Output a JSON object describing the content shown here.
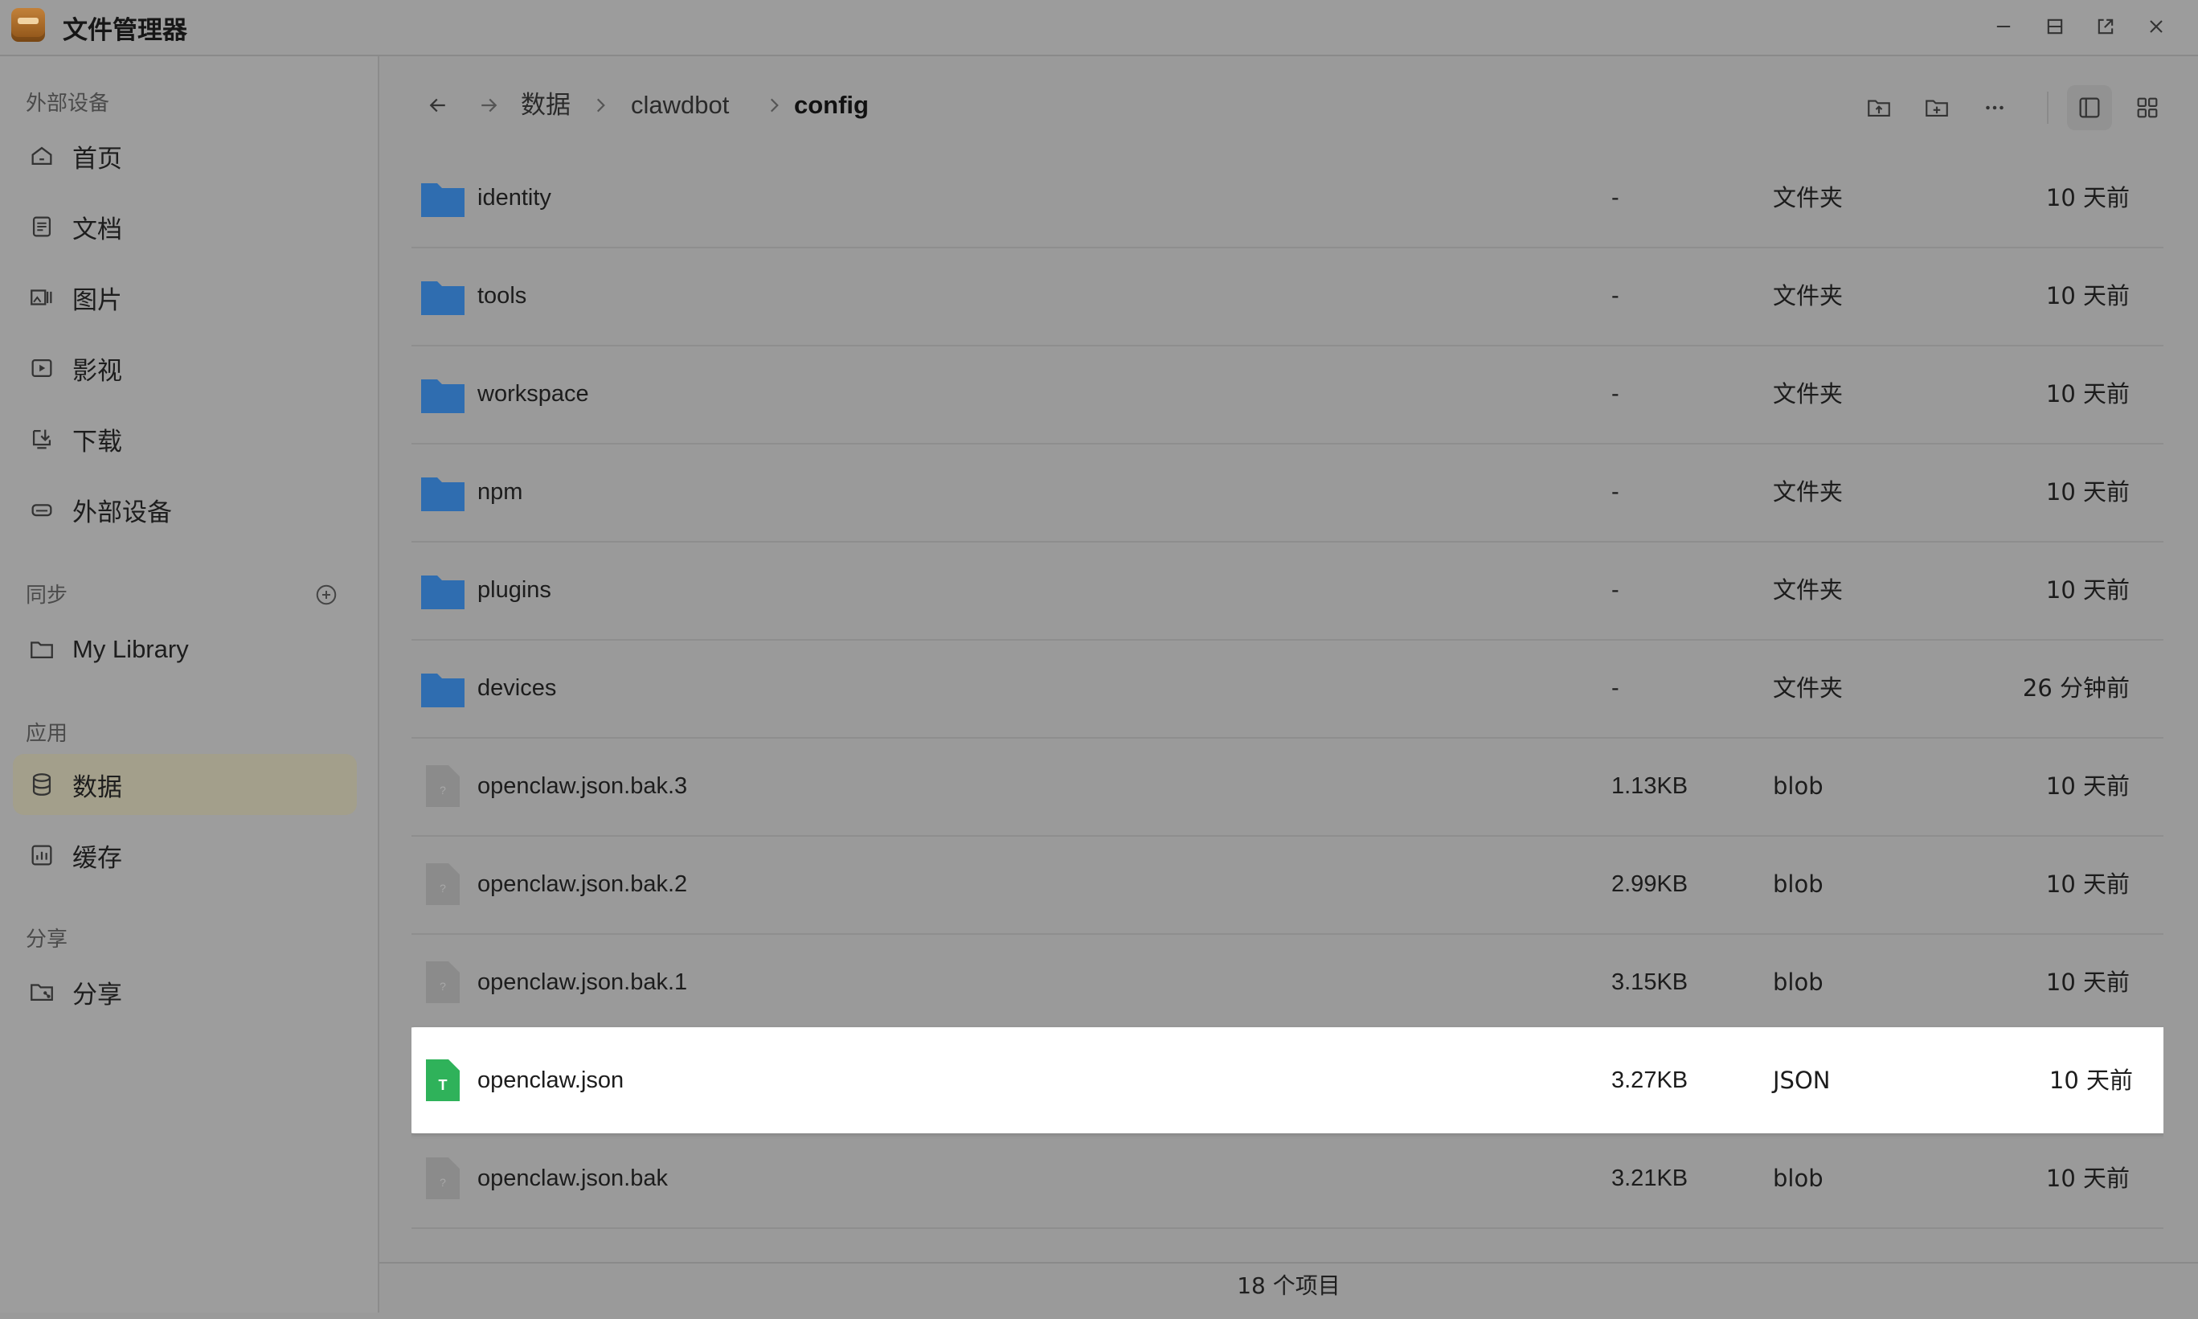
{
  "window": {
    "title": "文件管理器"
  },
  "sidebar": {
    "sections": {
      "external": "外部设备",
      "sync": "同步",
      "apps": "应用",
      "share": "分享"
    },
    "items": [
      {
        "label": "首页",
        "icon": "home-icon"
      },
      {
        "label": "文档",
        "icon": "document-icon"
      },
      {
        "label": "图片",
        "icon": "image-icon"
      },
      {
        "label": "影视",
        "icon": "video-icon"
      },
      {
        "label": "下载",
        "icon": "download-icon"
      },
      {
        "label": "外部设备",
        "icon": "drive-icon"
      }
    ],
    "sync_items": [
      {
        "label": "My Library",
        "icon": "folder-icon"
      }
    ],
    "app_items": [
      {
        "label": "数据",
        "icon": "database-icon",
        "active": true
      },
      {
        "label": "缓存",
        "icon": "cache-icon"
      }
    ],
    "share_items": [
      {
        "label": "分享",
        "icon": "shared-folder-icon"
      }
    ]
  },
  "breadcrumb": [
    "数据",
    "clawdbot",
    "config"
  ],
  "files": [
    {
      "name": "identity",
      "size": "-",
      "type": "文件夹",
      "modified": "10 天前",
      "kind": "folder"
    },
    {
      "name": "tools",
      "size": "-",
      "type": "文件夹",
      "modified": "10 天前",
      "kind": "folder"
    },
    {
      "name": "workspace",
      "size": "-",
      "type": "文件夹",
      "modified": "10 天前",
      "kind": "folder"
    },
    {
      "name": "npm",
      "size": "-",
      "type": "文件夹",
      "modified": "10 天前",
      "kind": "folder"
    },
    {
      "name": "plugins",
      "size": "-",
      "type": "文件夹",
      "modified": "10 天前",
      "kind": "folder"
    },
    {
      "name": "devices",
      "size": "-",
      "type": "文件夹",
      "modified": "26 分钟前",
      "kind": "folder"
    },
    {
      "name": "openclaw.json.bak.3",
      "size": "1.13KB",
      "type": "blob",
      "modified": "10 天前",
      "kind": "blob"
    },
    {
      "name": "openclaw.json.bak.2",
      "size": "2.99KB",
      "type": "blob",
      "modified": "10 天前",
      "kind": "blob"
    },
    {
      "name": "openclaw.json.bak.1",
      "size": "3.15KB",
      "type": "blob",
      "modified": "10 天前",
      "kind": "blob"
    },
    {
      "name": "openclaw.json",
      "size": "3.27KB",
      "type": "JSON",
      "modified": "10 天前",
      "kind": "json",
      "selected": true
    },
    {
      "name": "openclaw.json.bak",
      "size": "3.21KB",
      "type": "blob",
      "modified": "10 天前",
      "kind": "blob"
    }
  ],
  "status": {
    "count": "18 个项目"
  },
  "colors": {
    "folder": "#2f6db0",
    "json_icon": "#2fb25a",
    "blob_icon": "#8b8b8b",
    "active_sidebar": "#a39f8b"
  }
}
